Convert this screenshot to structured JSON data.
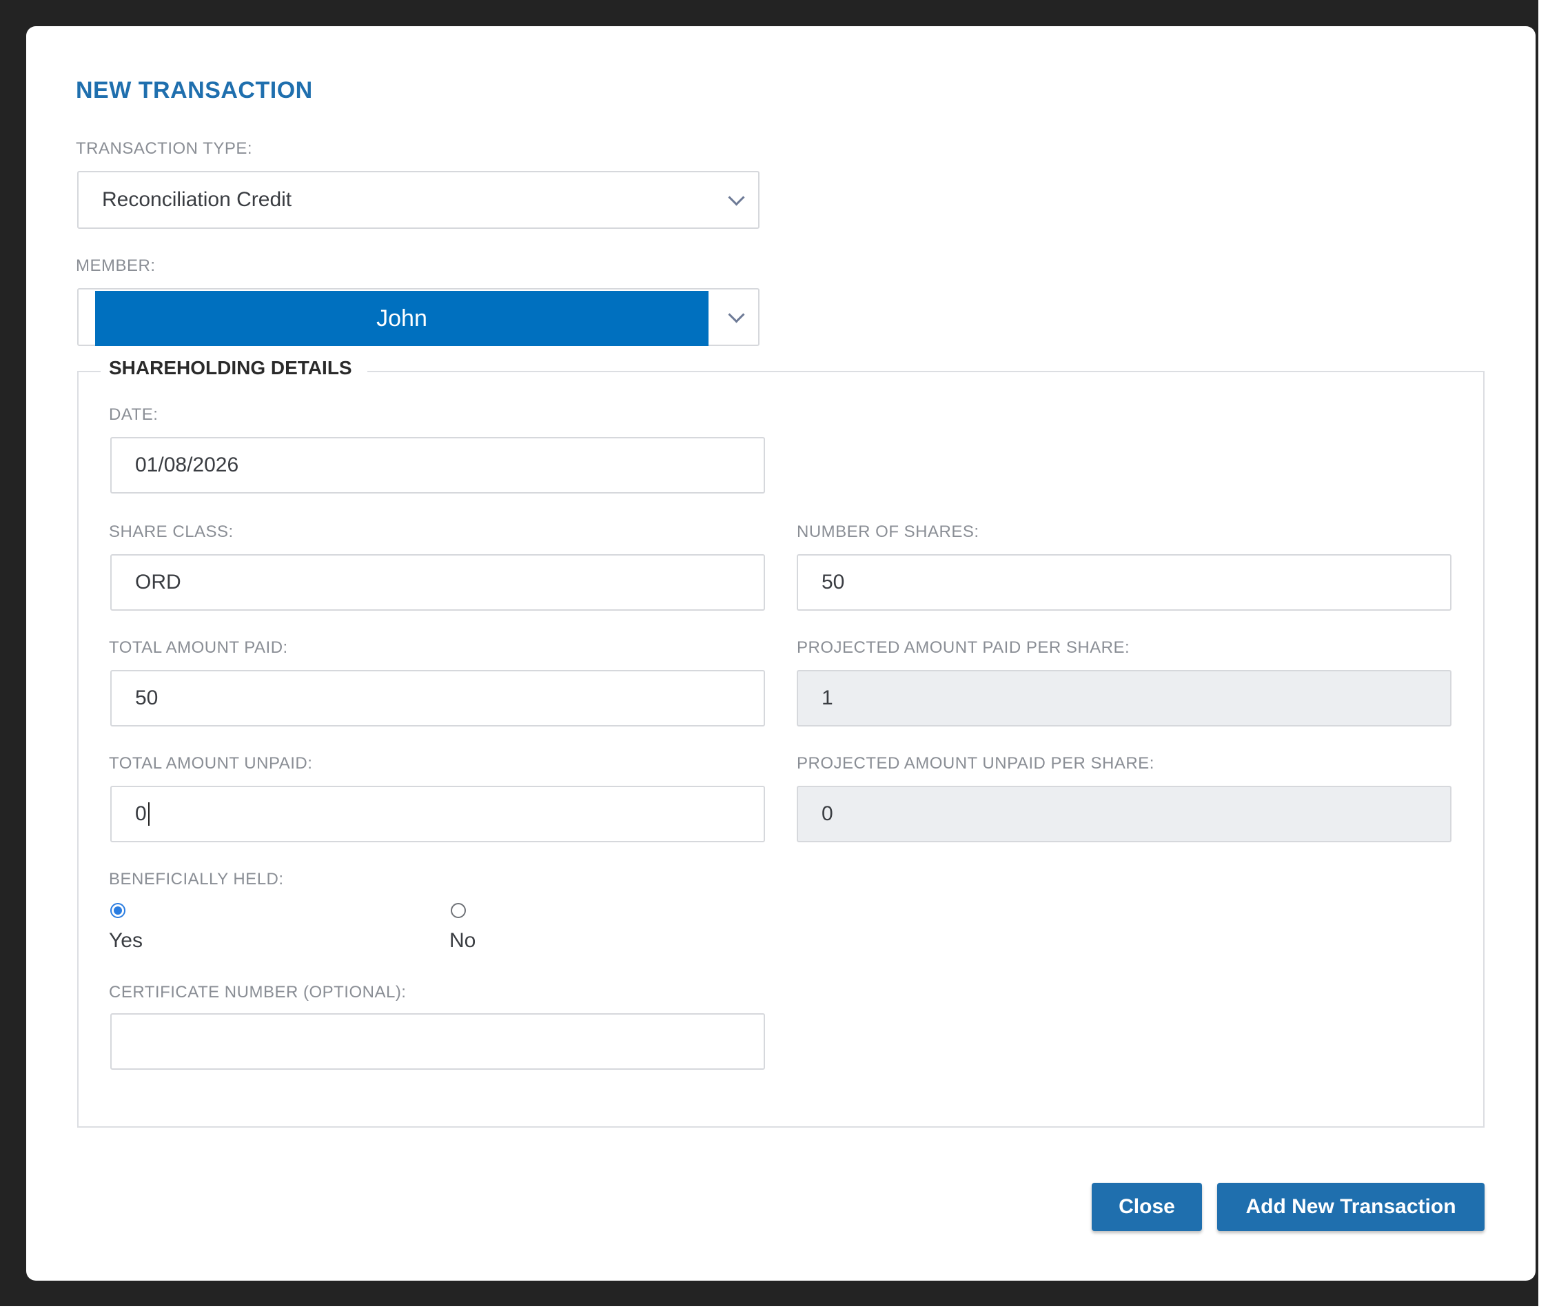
{
  "modal": {
    "title": "NEW TRANSACTION"
  },
  "transaction_type": {
    "label": "TRANSACTION TYPE:",
    "value": "Reconciliation Credit"
  },
  "member": {
    "label": "MEMBER:",
    "value": "John"
  },
  "shareholding": {
    "legend": "SHAREHOLDING DETAILS",
    "date": {
      "label": "DATE:",
      "value": "01/08/2026"
    },
    "share_class": {
      "label": "SHARE CLASS:",
      "value": "ORD"
    },
    "number_of_shares": {
      "label": "NUMBER OF SHARES:",
      "value": "50"
    },
    "total_amount_paid": {
      "label": "TOTAL AMOUNT PAID:",
      "value": "50"
    },
    "projected_paid_per_share": {
      "label": "PROJECTED AMOUNT PAID PER SHARE:",
      "value": "1"
    },
    "total_amount_unpaid": {
      "label": "TOTAL AMOUNT UNPAID:",
      "value": "0"
    },
    "projected_unpaid_per_share": {
      "label": "PROJECTED AMOUNT UNPAID PER SHARE:",
      "value": "0"
    },
    "beneficially_held": {
      "label": "BENEFICIALLY HELD:",
      "options": [
        {
          "label": "Yes",
          "checked": true
        },
        {
          "label": "No",
          "checked": false
        }
      ]
    },
    "certificate_number": {
      "label": "CERTIFICATE NUMBER (OPTIONAL):",
      "value": ""
    }
  },
  "buttons": {
    "close": "Close",
    "add": "Add New Transaction"
  },
  "colors": {
    "accent": "#1f6fae",
    "member_highlight": "#0070bf",
    "readonly_bg": "#eceef1",
    "radio_checked": "#2a7de1"
  },
  "icons": {
    "dropdown": "chevron-down-icon"
  }
}
